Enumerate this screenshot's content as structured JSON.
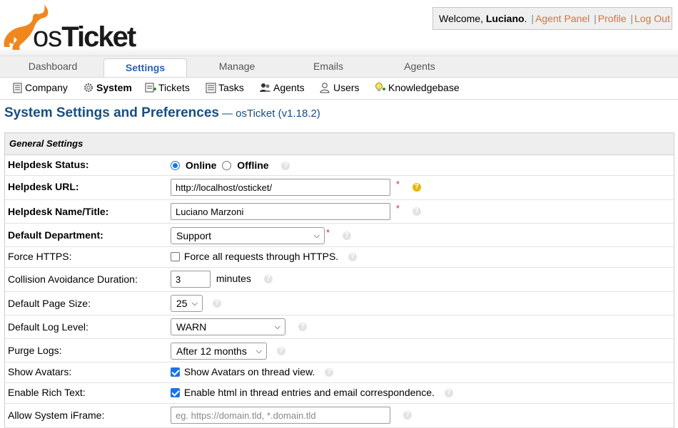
{
  "brand": {
    "logo_text_os": "os",
    "logo_text_ticket": "Ticket"
  },
  "userbox": {
    "welcome": "Welcome, ",
    "username": "Luciano",
    "suffix": ".",
    "agent_panel": "Agent Panel",
    "profile": "Profile",
    "logout": "Log Out",
    "separator": "|"
  },
  "nav": {
    "tabs": [
      {
        "label": "Dashboard"
      },
      {
        "label": "Settings"
      },
      {
        "label": "Manage"
      },
      {
        "label": "Emails"
      },
      {
        "label": "Agents"
      }
    ],
    "active": "Settings"
  },
  "subnav": {
    "items": [
      {
        "label": "Company",
        "icon": "company-icon"
      },
      {
        "label": "System",
        "icon": "gear-icon"
      },
      {
        "label": "Tickets",
        "icon": "tickets-icon"
      },
      {
        "label": "Tasks",
        "icon": "tasks-icon"
      },
      {
        "label": "Agents",
        "icon": "agents-icon"
      },
      {
        "label": "Users",
        "icon": "users-icon"
      },
      {
        "label": "Knowledgebase",
        "icon": "knowledgebase-icon"
      }
    ],
    "active": "System"
  },
  "page": {
    "title": "System Settings and Preferences",
    "subtitle": "— osTicket (v1.18.2)"
  },
  "general": {
    "section_title": "General Settings",
    "helpdesk_status": {
      "label": "Helpdesk Status:",
      "online": "Online",
      "offline": "Offline",
      "value": "Online"
    },
    "helpdesk_url": {
      "label": "Helpdesk URL:",
      "value": "http://localhost/osticket/",
      "required": "*"
    },
    "helpdesk_name": {
      "label": "Helpdesk Name/Title:",
      "value": "Luciano Marzoni",
      "required": "*"
    },
    "default_department": {
      "label": "Default Department:",
      "value": "Support",
      "required": "*"
    },
    "force_https": {
      "label": "Force HTTPS:",
      "text": "Force all requests through HTTPS.",
      "checked": false
    },
    "collision": {
      "label": "Collision Avoidance Duration:",
      "value": "3",
      "unit": "minutes"
    },
    "page_size": {
      "label": "Default Page Size:",
      "value": "25"
    },
    "log_level": {
      "label": "Default Log Level:",
      "value": "WARN"
    },
    "purge_logs": {
      "label": "Purge Logs:",
      "value": "After 12 months"
    },
    "show_avatars": {
      "label": "Show Avatars:",
      "text": "Show Avatars on thread view.",
      "checked": true
    },
    "rich_text": {
      "label": "Enable Rich Text:",
      "text": "Enable html in thread entries and email correspondence.",
      "checked": true
    },
    "iframe": {
      "label": "Allow System iFrame:",
      "value": "",
      "placeholder": "eg. https://domain.tld, *.domain.tld"
    }
  },
  "colors": {
    "accent_link": "#d9713b",
    "title_blue": "#184e81",
    "tab_active": "#2b63a6",
    "logo_orange": "#f0871e",
    "required": "#d03030",
    "check_blue": "#1a73e8"
  }
}
